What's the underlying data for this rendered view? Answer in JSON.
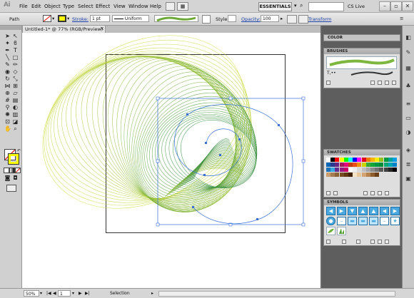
{
  "app": {
    "logo": "Ai"
  },
  "menu": [
    "File",
    "Edit",
    "Object",
    "Type",
    "Select",
    "Effect",
    "View",
    "Window",
    "Help"
  ],
  "workspace": "ESSENTIALS",
  "cs_live": "CS Live",
  "control_bar": {
    "selection_label": "Path",
    "stroke_label": "Stroke:",
    "stroke_weight": "1 pt",
    "profile": "Uniform",
    "style_label": "Style:",
    "opacity_label": "Opacity:",
    "opacity_value": "100",
    "transform_label": "Transform"
  },
  "document_tab": "Untitled-1* @ 77% (RGB/Preview)",
  "panels": {
    "color": "COLOR",
    "brushes": "BRUSHES",
    "swatches": "SWATCHES",
    "symbols": "SYMBOLS"
  },
  "status": {
    "zoom": "50%",
    "artboard": "1",
    "tool": "Selection"
  },
  "colors": {
    "spiral_yellow": "#cfdc3a",
    "spiral_green": "#2e8a3c",
    "selection_blue": "#3b6fd6",
    "fill": "#ffffff",
    "stroke_highlight": "#ffff00",
    "symbol_blue": "#4aa8e0"
  },
  "swatch_colors": [
    "#ffffff",
    "#000000",
    "#ff0000",
    "#ffff00",
    "#00ff00",
    "#00ffff",
    "#0000ff",
    "#ff00ff",
    "#e2001a",
    "#ef7d00",
    "#f9b200",
    "#ffed00",
    "#95c11f",
    "#009a3e",
    "#00a19a",
    "#009fe3",
    "#0066b3",
    "#2a3990",
    "#662483",
    "#a3195b",
    "#e6007e",
    "#c63d0f",
    "#e94e1b",
    "#f39200",
    "#c8d300",
    "#3aaa35",
    "#13a538",
    "#00963f",
    "#008d36",
    "#00a774",
    "#00a5b2",
    "#0082c9",
    "#1d71b8",
    "#36a9e1",
    "#662d91",
    "#951b81",
    "#cc0066",
    "#ffffff",
    "#f0f0f0",
    "#d9d9d9",
    "#bfbfbf",
    "#a6a6a6",
    "#8c8c8c",
    "#737373",
    "#595959",
    "#404040",
    "#262626",
    "#000000",
    "#c69c6d",
    "#a67c52",
    "#8c6239",
    "#754c24",
    "#603913",
    "#42210b",
    "#f7e4c6",
    "#e8c89b",
    "#d4a373",
    "#b5814c",
    "#8e5e2f",
    "#6b3f17"
  ]
}
